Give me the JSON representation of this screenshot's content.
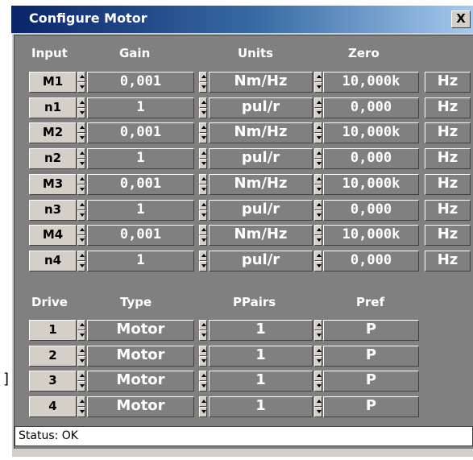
{
  "window": {
    "title": "Configure Motor",
    "close_label": "X"
  },
  "input_headers": {
    "input": "Input",
    "gain": "Gain",
    "units": "Units",
    "zero": "Zero"
  },
  "inputs": [
    {
      "name": "M1",
      "gain": "0,001",
      "units": "Nm/Hz",
      "zero": "10,000k",
      "zero_unit": "Hz"
    },
    {
      "name": "n1",
      "gain": "1",
      "units": "pul/r",
      "zero": "0,000",
      "zero_unit": "Hz"
    },
    {
      "name": "M2",
      "gain": "0,001",
      "units": "Nm/Hz",
      "zero": "10,000k",
      "zero_unit": "Hz"
    },
    {
      "name": "n2",
      "gain": "1",
      "units": "pul/r",
      "zero": "0,000",
      "zero_unit": "Hz"
    },
    {
      "name": "M3",
      "gain": "0,001",
      "units": "Nm/Hz",
      "zero": "10,000k",
      "zero_unit": "Hz"
    },
    {
      "name": "n3",
      "gain": "1",
      "units": "pul/r",
      "zero": "0,000",
      "zero_unit": "Hz"
    },
    {
      "name": "M4",
      "gain": "0,001",
      "units": "Nm/Hz",
      "zero": "10,000k",
      "zero_unit": "Hz"
    },
    {
      "name": "n4",
      "gain": "1",
      "units": "pul/r",
      "zero": "0,000",
      "zero_unit": "Hz"
    }
  ],
  "drive_headers": {
    "drive": "Drive",
    "type": "Type",
    "ppairs": "PPairs",
    "pref": "Pref"
  },
  "drives": [
    {
      "num": "1",
      "type": "Motor",
      "ppairs": "1",
      "pref": "P"
    },
    {
      "num": "2",
      "type": "Motor",
      "ppairs": "1",
      "pref": "P"
    },
    {
      "num": "3",
      "type": "Motor",
      "ppairs": "1",
      "pref": "P"
    },
    {
      "num": "4",
      "type": "Motor",
      "ppairs": "1",
      "pref": "P"
    }
  ],
  "status": "Status: OK",
  "stray_mark": "]",
  "colors": {
    "title_start": "#0a246a",
    "title_end": "#a6caf0",
    "panel": "#808080",
    "face": "#d4d0c8",
    "field_text": "#ffffff"
  }
}
